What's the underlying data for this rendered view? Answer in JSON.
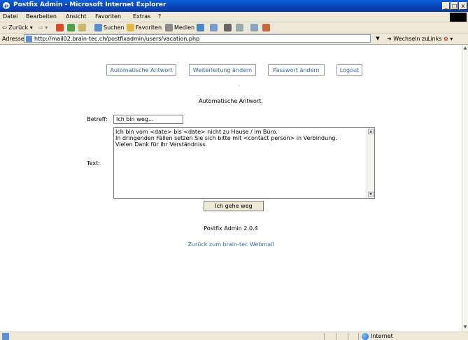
{
  "window": {
    "title": "Postfix Admin - Microsoft Internet Explorer"
  },
  "menu": [
    {
      "label": "Datei",
      "accel": "D"
    },
    {
      "label": "Bearbeiten",
      "accel": "B"
    },
    {
      "label": "Ansicht",
      "accel": "A"
    },
    {
      "label": "Favoriten",
      "accel": "F"
    },
    {
      "label": "Extras",
      "accel": "x"
    },
    {
      "label": "?",
      "accel": ""
    }
  ],
  "toolbar": {
    "back": "Zurück",
    "search": "Suchen",
    "favorites": "Favoriten",
    "media": "Medien"
  },
  "address": {
    "label": "Adresse",
    "url": "http://mail02.brain-tec.ch/postfixadmin/users/vacation.php",
    "go": "Wechseln zu",
    "links": "Links"
  },
  "page": {
    "nav": [
      "Automatische Antwort",
      "Weiterleitung ändern",
      "Passwort ändern",
      "Logout"
    ],
    "heading": "Automatische Antwort.",
    "subject_label": "Betreff:",
    "subject_value": "Ich bin weg...",
    "text_label": "Text:",
    "text_lines": [
      "Ich bin vom <date> bis <date> nicht zu Hause / im Büro.",
      "In dringenden Fällen setzen Sie sich bitte mit <contact person> in Verbindung.",
      "Vielen Dank für Ihr Verständniss."
    ],
    "submit": "Ich gehe weg",
    "footer": "Postfix Admin 2.0.4",
    "back_link": "Zurück zum brain-tec Webmail"
  },
  "status": {
    "zone": "Internet"
  },
  "colors": {
    "titlebar": "#0843b8",
    "link": "#336699",
    "chrome": "#ece9d8"
  }
}
